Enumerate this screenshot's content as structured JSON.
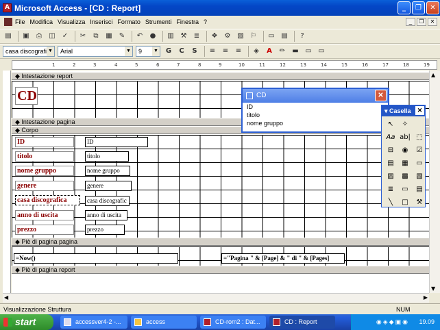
{
  "window": {
    "title": "Microsoft Access - [CD : Report]",
    "app_icon": "access-icon"
  },
  "menubar": {
    "items": [
      "File",
      "Modifica",
      "Visualizza",
      "Inserisci",
      "Formato",
      "Strumenti",
      "Finestra",
      "?"
    ]
  },
  "format_toolbar": {
    "object_combo": "casa discografic",
    "font_combo": "Arial",
    "size_combo": "9",
    "bold": "G",
    "italic": "C",
    "underline": "S"
  },
  "ruler": {
    "marks": [
      "1",
      "2",
      "3",
      "4",
      "5",
      "6",
      "7",
      "8",
      "9",
      "10",
      "11",
      "12",
      "13",
      "14",
      "15",
      "16",
      "17",
      "18",
      "19"
    ]
  },
  "report": {
    "sections": {
      "report_header": "Intestazione report",
      "page_header": "Intestazione pagina",
      "detail": "Corpo",
      "page_footer": "Piè di pagina pagina",
      "report_footer": "Piè di pagina report"
    },
    "title": "CD",
    "fields": [
      {
        "label": "ID",
        "control": "ID"
      },
      {
        "label": "titolo",
        "control": "titolo"
      },
      {
        "label": "nome gruppo",
        "control": "nome gruppo"
      },
      {
        "label": "genere",
        "control": "genere"
      },
      {
        "label": "casa discografica",
        "control": "casa discografic"
      },
      {
        "label": "anno di uscita",
        "control": "anno di uscita"
      },
      {
        "label": "prezzo",
        "control": "prezzo"
      }
    ],
    "footer_now": "=Now()",
    "footer_page": "=\"Pagina \" & [Page] & \" di \" & [Pages]"
  },
  "field_list": {
    "title": "CD",
    "items": [
      "ID",
      "titolo",
      "nome gruppo"
    ]
  },
  "toolbox": {
    "title": "Casella",
    "tools": [
      "pointer-icon",
      "wizard-icon",
      "",
      "label-tool-icon",
      "textbox-tool-icon",
      "option-group-icon",
      "toggle-icon",
      "radio-icon",
      "checkbox-icon",
      "combobox-icon",
      "listbox-icon",
      "button-icon",
      "image-icon",
      "unbound-object-icon",
      "bound-object-icon",
      "page-break-icon",
      "tab-control-icon",
      "subreport-icon",
      "line-icon",
      "rectangle-icon",
      "more-tools-icon"
    ]
  },
  "status": {
    "left": "Visualizzazione Struttura",
    "num": "NUM"
  },
  "taskbar": {
    "start": "start",
    "tasks": [
      "accessver4-2 -...",
      "access",
      "CD-rom2 : Dat...",
      "CD : Report"
    ],
    "clock": "19.09"
  }
}
